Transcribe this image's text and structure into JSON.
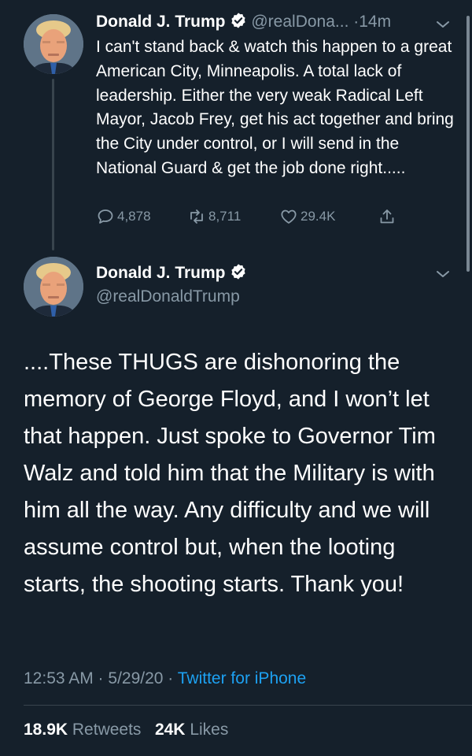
{
  "colors": {
    "background": "#15202b",
    "text": "#ffffff",
    "muted": "#8899a6",
    "link": "#1da1f2",
    "verified": "#ffffff"
  },
  "tweet1": {
    "name": "Donald J. Trump",
    "handle": "@realDona...",
    "time": "·14m",
    "text": "I can't stand back & watch this happen to a great American City, Minneapolis. A total lack of leadership. Either the very weak Radical Left Mayor, Jacob Frey, get his act together and bring the City under control, or I will send in the National Guard & get the job done right.....",
    "replies": "4,878",
    "retweets": "8,711",
    "likes": "29.4K",
    "icons": [
      "reply-icon",
      "retweet-icon",
      "like-icon",
      "share-icon",
      "verified-icon",
      "chevron-down-icon"
    ]
  },
  "tweet2": {
    "name": "Donald J. Trump",
    "handle": "@realDonaldTrump",
    "text": "....These THUGS are dishonoring the memory of George Floyd, and I won’t let that happen. Just spoke to Governor Tim Walz and told him that the Military is with him all the way. Any difficulty and we will assume control but, when the looting starts, the shooting starts. Thank you!",
    "timestamp": "12:53 AM · 5/29/20 · ",
    "source": "Twitter for iPhone",
    "retweet_count": "18.9K",
    "retweet_label": "Retweets",
    "like_count": "24K",
    "like_label": "Likes"
  }
}
